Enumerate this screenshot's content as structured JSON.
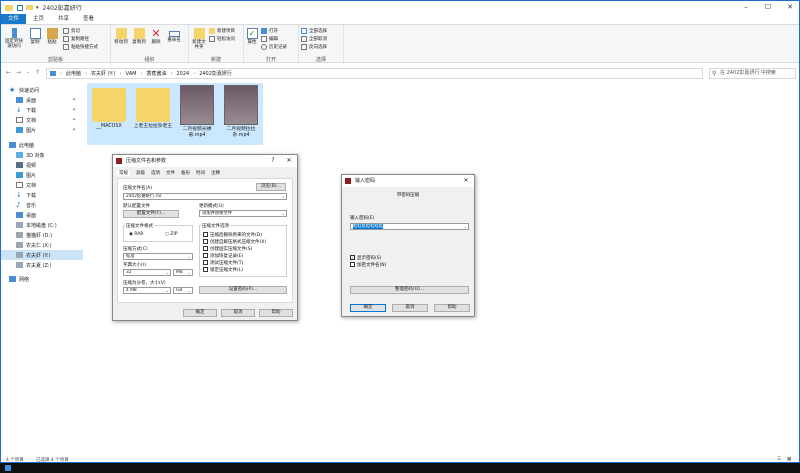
{
  "explorer": {
    "title": "2402彭嘉妍行",
    "tabs": [
      "文件",
      "主页",
      "共享",
      "查看"
    ],
    "ribbon": {
      "pin_label": "固定到快速访问",
      "copy_label": "复制",
      "paste_label": "粘贴",
      "cut_label": "剪切",
      "copy_path_label": "复制路径",
      "paste_shortcut_label": "粘贴快捷方式",
      "clipboard_group": "剪贴板",
      "move_to_label": "移动到",
      "copy_to_label": "复制到",
      "delete_label": "删除",
      "rename_label": "重命名",
      "organize_group": "组织",
      "new_folder_label": "新建文件夹",
      "new_item_label": "新建项目",
      "easy_access_label": "轻松访问",
      "new_group": "新建",
      "properties_label": "属性",
      "open_label": "打开",
      "edit_label": "编辑",
      "history_label": "历史记录",
      "open_group": "打开",
      "select_all_label": "全部选择",
      "select_none_label": "全部取消",
      "invert_label": "反向选择",
      "select_group": "选择"
    },
    "breadcrumb": [
      "此电脑",
      "农夫虾 (Y:)",
      "VAM",
      "香蕉酱油",
      "2024",
      "2402彭嘉妍行"
    ],
    "search_placeholder": "在 2402彭嘉妍行 中搜索",
    "nav": [
      {
        "label": "快速访问",
        "icon": "star-icon"
      },
      {
        "label": "桌面",
        "icon": "desktop-icon"
      },
      {
        "label": "下载",
        "icon": "download-icon"
      },
      {
        "label": "文档",
        "icon": "document-icon"
      },
      {
        "label": "图片",
        "icon": "picture-icon"
      },
      {
        "label": "此电脑",
        "icon": "computer-icon"
      },
      {
        "label": "3D 对象",
        "icon": "3d-icon"
      },
      {
        "label": "视频",
        "icon": "video-icon"
      },
      {
        "label": "图片",
        "icon": "picture-icon"
      },
      {
        "label": "文档",
        "icon": "document-icon"
      },
      {
        "label": "下载",
        "icon": "download-icon"
      },
      {
        "label": "音乐",
        "icon": "music-icon"
      },
      {
        "label": "桌面",
        "icon": "desktop-icon"
      },
      {
        "label": "本地磁盘 (C:)",
        "icon": "drive-icon"
      },
      {
        "label": "猫猫虾 (D:)",
        "icon": "drive-icon"
      },
      {
        "label": "农夫仁 (X:)",
        "icon": "drive-icon"
      },
      {
        "label": "农夫虾 (Y:)",
        "icon": "drive-icon"
      },
      {
        "label": "农夫夏 (Z:)",
        "icon": "drive-icon"
      },
      {
        "label": "网络",
        "icon": "network-icon"
      }
    ],
    "files": [
      {
        "name": "__MACOSX",
        "type": "folder"
      },
      {
        "name": "上老王拉拉杂老王",
        "type": "folder"
      },
      {
        "name": "二月视频光裸悬.mp4",
        "type": "video"
      },
      {
        "name": "二月视频拉拉杂.mp4",
        "type": "video"
      }
    ],
    "status_count": "4 个项目",
    "status_selected": "已选择 4 个项目"
  },
  "archive_dialog": {
    "title": "压缩文件名和参数",
    "help_mark": "?",
    "tabs": [
      "常规",
      "高级",
      "选项",
      "文件",
      "备份",
      "时间",
      "注释"
    ],
    "filename_label": "压缩文件名(A)",
    "browse_button": "浏览(B)...",
    "filename_value": "2402彭嘉妍行.rar",
    "default_profile_label": "默认配置文件",
    "profiles_button": "配置文件(F)...",
    "update_mode_label": "更新模式(U)",
    "update_mode_value": "添加并替换文件",
    "format_label": "压缩文件格式",
    "format_options": [
      "RAR",
      "ZIP"
    ],
    "method_label": "压缩方式(C)",
    "method_value": "标准",
    "dict_label": "字典大小(I)",
    "dict_value": "32",
    "dict_unit": "MB",
    "split_label": "压缩为分卷，大小(V)",
    "split_value": "4 MB",
    "split_unit": "GB",
    "options_label": "压缩文件选项",
    "options": [
      "压缩后删除原来的文件(D)",
      "创建自解压格式压缩文件(X)",
      "创建固实压缩文件(S)",
      "添加恢复记录(E)",
      "测试压缩文件(T)",
      "锁定压缩文件(L)"
    ],
    "password_button": "设置密码(P)...",
    "ok_button": "确定",
    "cancel_button": "取消",
    "help_button": "帮助"
  },
  "password_dialog": {
    "title": "输入密码",
    "subtitle": "带密码压缩",
    "enter_label": "输入密码(E)",
    "password_value": "蛙蛙蛙蛙蛙蛙蛙",
    "show_password_label": "显示密码(S)",
    "encrypt_names_label": "加密文件名(N)",
    "manage_button": "整理密码(O)...",
    "ok_button": "确定",
    "cancel_button": "取消",
    "help_button": "帮助"
  },
  "colors": {
    "accent": "#1979ca",
    "selection": "#cce8ff",
    "folder": "#f5d46a"
  }
}
